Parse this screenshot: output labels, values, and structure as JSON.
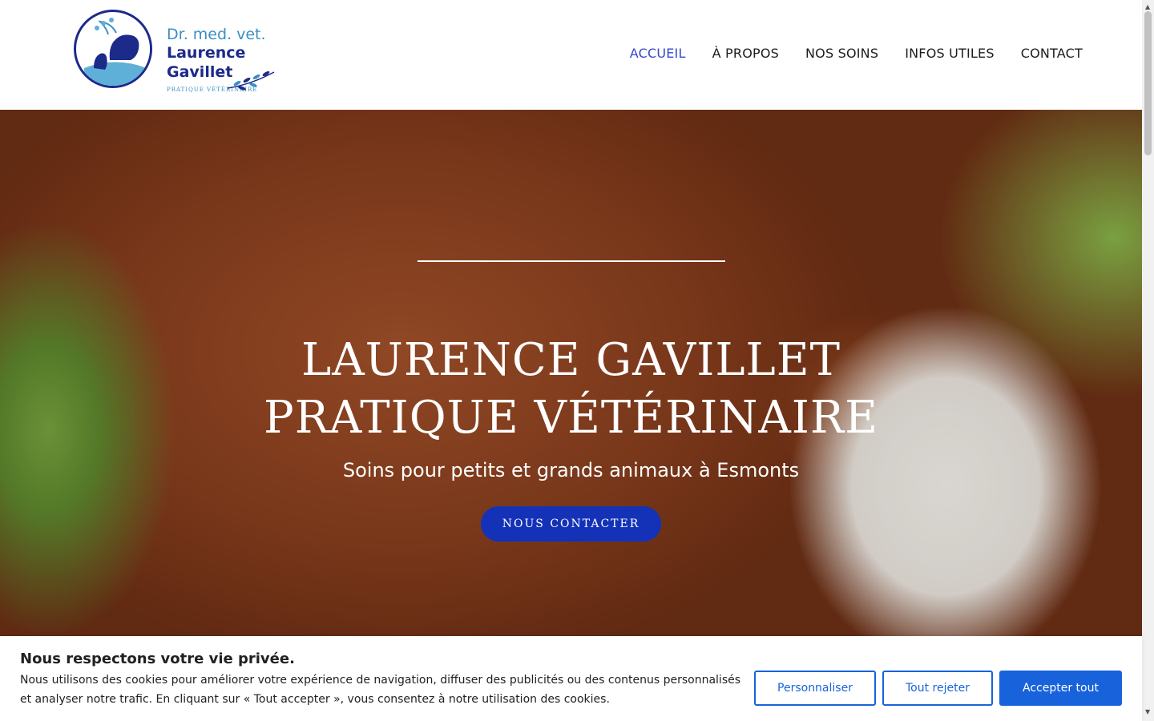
{
  "header": {
    "logo": {
      "line1": "Dr. med. vet.",
      "line2": "Laurence Gavillet",
      "line3": "PRATIQUE VÉTÉRINAIRE"
    },
    "nav": [
      {
        "label": "ACCUEIL",
        "active": true
      },
      {
        "label": "À PROPOS",
        "active": false
      },
      {
        "label": "NOS SOINS",
        "active": false
      },
      {
        "label": "INFOS UTILES",
        "active": false
      },
      {
        "label": "CONTACT",
        "active": false
      }
    ]
  },
  "hero": {
    "title_line1": "LAURENCE GAVILLET",
    "title_line2": "PRATIQUE VÉTÉRINAIRE",
    "subtitle": "Soins pour petits et grands animaux à Esmonts",
    "cta": "NOUS CONTACTER",
    "image_icon": "calf-photo"
  },
  "cookie_banner": {
    "title": "Nous respectons votre vie privée.",
    "text": "Nous utilisons des cookies pour améliorer votre expérience de navigation, diffuser des publicités ou des contenus personnalisés et analyser notre trafic. En cliquant sur « Tout accepter », vous consentez à notre utilisation des cookies.",
    "buttons": {
      "customize": "Personnaliser",
      "reject": "Tout rejeter",
      "accept": "Accepter tout"
    }
  },
  "colors": {
    "brand_navy": "#1c2a8a",
    "brand_light_blue": "#3a8fc5",
    "nav_active": "#3548c9",
    "cta_blue": "#1432b8",
    "cookie_blue": "#1863dc"
  }
}
